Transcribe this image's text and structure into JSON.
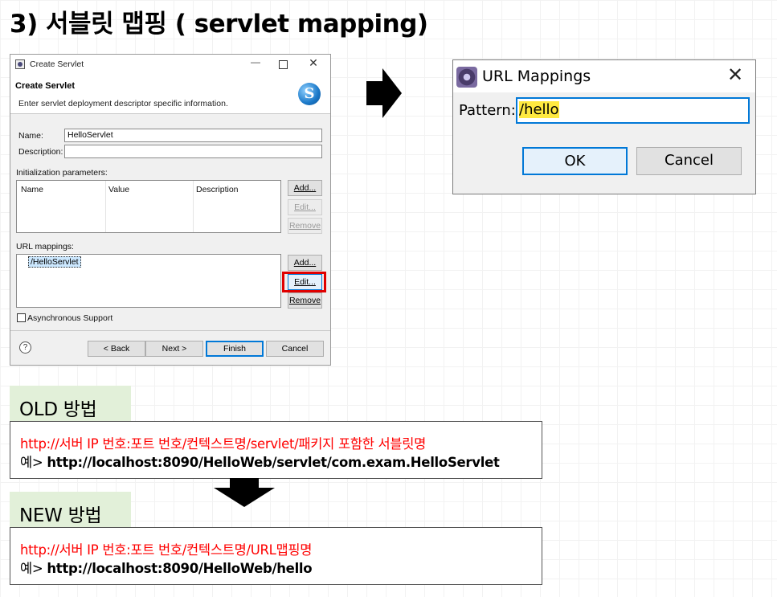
{
  "slide": {
    "title": "3) 서블릿 맵핑 ( servlet mapping)"
  },
  "create_servlet_dialog": {
    "window_title": "Create Servlet",
    "header_title": "Create Servlet",
    "header_description": "Enter servlet deployment descriptor specific information.",
    "logo_letter": "S",
    "name_label": "Name:",
    "name_value": "HelloServlet",
    "description_label": "Description:",
    "description_value": "",
    "init_params_label": "Initialization parameters:",
    "init_params_columns": [
      "Name",
      "Value",
      "Description"
    ],
    "init_params_buttons": {
      "add": "Add...",
      "edit": "Edit...",
      "remove": "Remove"
    },
    "url_mappings_label": "URL mappings:",
    "url_mappings_items": [
      "/HelloServlet"
    ],
    "url_mappings_buttons": {
      "add": "Add...",
      "edit": "Edit...",
      "remove": "Remove"
    },
    "async_label": "Asynchronous Support",
    "async_checked": false,
    "help_glyph": "?",
    "footer_buttons": {
      "back": "< Back",
      "next": "Next >",
      "finish": "Finish",
      "cancel": "Cancel"
    },
    "window_controls": {
      "minimize": "—",
      "close": "✕"
    }
  },
  "url_mappings_dialog": {
    "window_title": "URL Mappings",
    "close_glyph": "✕",
    "pattern_label": "Pattern:",
    "pattern_value": "/hello",
    "ok_label": "OK",
    "cancel_label": "Cancel"
  },
  "old_method": {
    "label": "OLD 방법",
    "format": "http://서버 IP 번호:포트 번호/컨텍스트명/servlet/패키지 포함한 서블릿명",
    "example_prefix": "예> ",
    "example_url": "http://localhost:8090/HelloWeb/servlet/com.exam.HelloServlet"
  },
  "new_method": {
    "label": "NEW 방법",
    "format": "http://서버 IP 번호:포트 번호/컨텍스트명/URL맵핑명",
    "example_prefix": "예> ",
    "example_url": "http://localhost:8090/HelloWeb/hello"
  },
  "colors": {
    "accent_red": "#ff0000",
    "highlight_yellow": "#ffe940",
    "section_tab_green": "#e2f0d9",
    "focus_blue": "#0078d7"
  }
}
